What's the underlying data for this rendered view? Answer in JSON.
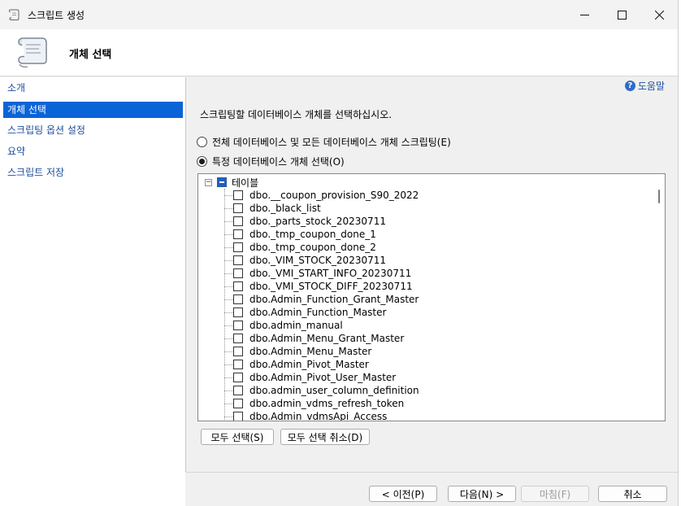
{
  "window": {
    "title": "스크립트 생성",
    "controls": {
      "minimize": "—",
      "maximize": "☐",
      "close": "✕"
    }
  },
  "header": {
    "title": "개체 선택"
  },
  "sidebar": {
    "items": [
      {
        "label": "소개"
      },
      {
        "label": "개체 선택"
      },
      {
        "label": "스크립팅 옵션 설정"
      },
      {
        "label": "요약"
      },
      {
        "label": "스크립트 저장"
      }
    ],
    "selected_index": 1
  },
  "content": {
    "help_label": "도움말",
    "instruction": "스크립팅할 데이터베이스 개체를 선택하십시오.",
    "radio_all_label": "전체 데이터베이스 및 모든 데이터베이스 개체 스크립팅(E)",
    "radio_specific_label": "특정 데이터베이스 개체 선택(O)",
    "selected_radio": "specific"
  },
  "tree": {
    "root_label": "테이블",
    "root_state": "indeterminate",
    "items": [
      "dbo.__coupon_provision_S90_2022",
      "dbo._black_list",
      "dbo._parts_stock_20230711",
      "dbo._tmp_coupon_done_1",
      "dbo._tmp_coupon_done_2",
      "dbo._VIM_STOCK_20230711",
      "dbo._VMI_START_INFO_20230711",
      "dbo._VMI_STOCK_DIFF_20230711",
      "dbo.Admin_Function_Grant_Master",
      "dbo.Admin_Function_Master",
      "dbo.admin_manual",
      "dbo.Admin_Menu_Grant_Master",
      "dbo.Admin_Menu_Master",
      "dbo.Admin_Pivot_Master",
      "dbo.Admin_Pivot_User_Master",
      "dbo.admin_user_column_definition",
      "dbo.admin_vdms_refresh_token",
      "dbo.Admin_vdmsApi_Access"
    ]
  },
  "buttons": {
    "select_all": "모두 선택(S)",
    "deselect_all": "모두 선택 취소(D)",
    "prev": "< 이전(P)",
    "next": "다음(N) >",
    "finish": "마침(F)",
    "cancel": "취소"
  },
  "colors": {
    "accent": "#0a64d8",
    "link": "#1d4f9c"
  }
}
